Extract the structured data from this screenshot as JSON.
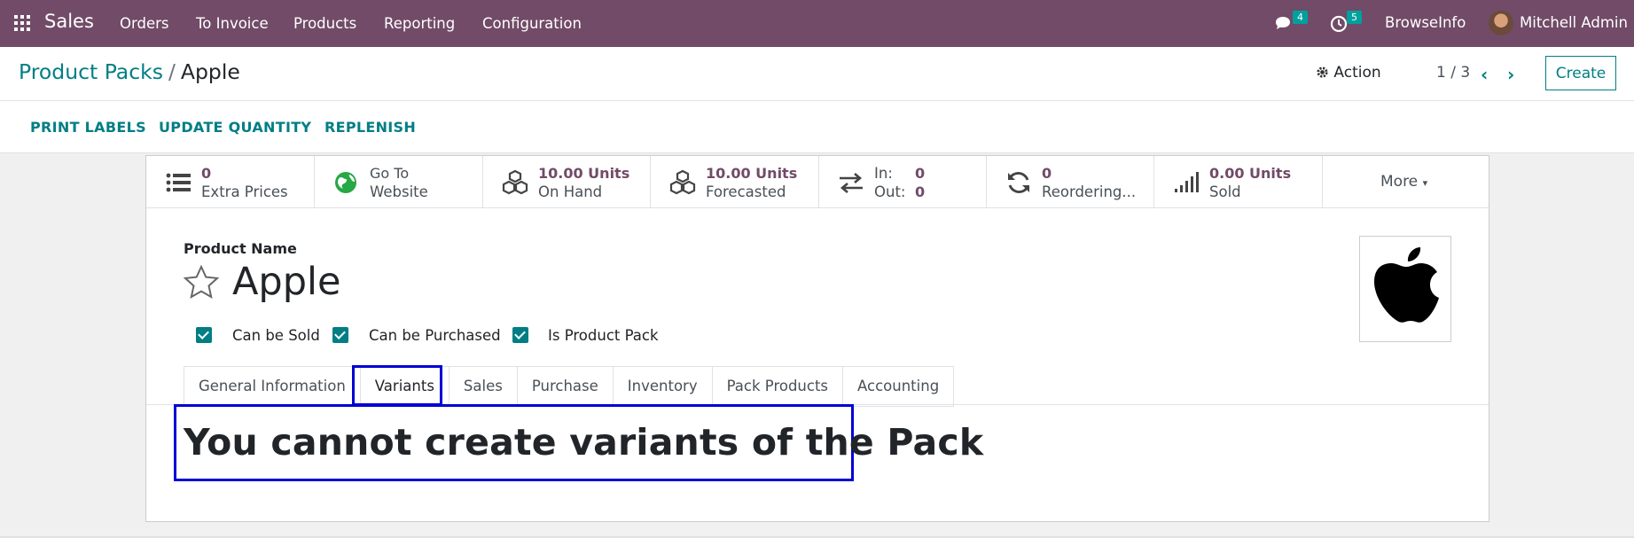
{
  "navbar": {
    "app_name": "Sales",
    "menu": [
      "Orders",
      "To Invoice",
      "Products",
      "Reporting",
      "Configuration"
    ],
    "messages_count": "4",
    "activities_count": "5",
    "company": "BrowseInfo",
    "user": "Mitchell Admin"
  },
  "breadcrumb": {
    "parent": "Product Packs",
    "separator": "/",
    "current": "Apple"
  },
  "control": {
    "action_label": "Action",
    "pager": "1 / 3",
    "create_label": "Create"
  },
  "statusbar": {
    "buttons": [
      "PRINT LABELS",
      "UPDATE QUANTITY",
      "REPLENISH"
    ]
  },
  "stats": [
    {
      "icon": "list-icon",
      "value": "0",
      "label": "Extra Prices"
    },
    {
      "icon": "globe-icon",
      "value": "Go To",
      "label": "Website"
    },
    {
      "icon": "cubes-icon",
      "value": "10.00 Units",
      "label": "On Hand"
    },
    {
      "icon": "cubes-icon",
      "value": "10.00 Units",
      "label": "Forecasted"
    },
    {
      "icon": "exchange-icon",
      "in_label": "In:",
      "in_value": "0",
      "out_label": "Out:",
      "out_value": "0"
    },
    {
      "icon": "refresh-icon",
      "value": "0",
      "label": "Reordering..."
    },
    {
      "icon": "signal-icon",
      "value": "0.00 Units",
      "label": "Sold"
    }
  ],
  "more_label": "More",
  "product": {
    "name_label": "Product Name",
    "name": "Apple",
    "checkboxes": [
      {
        "label": "Can be Sold",
        "checked": true
      },
      {
        "label": "Can be Purchased",
        "checked": true
      },
      {
        "label": "Is Product Pack",
        "checked": true
      }
    ]
  },
  "tabs": [
    "General Information",
    "Variants",
    "Sales",
    "Purchase",
    "Inventory",
    "Pack Products",
    "Accounting"
  ],
  "active_tab": "Variants",
  "variants_message": "You cannot create variants of the Pack",
  "colors": {
    "navbar": "#714b67",
    "accent": "#017e84",
    "highlight": "#0000d4"
  }
}
